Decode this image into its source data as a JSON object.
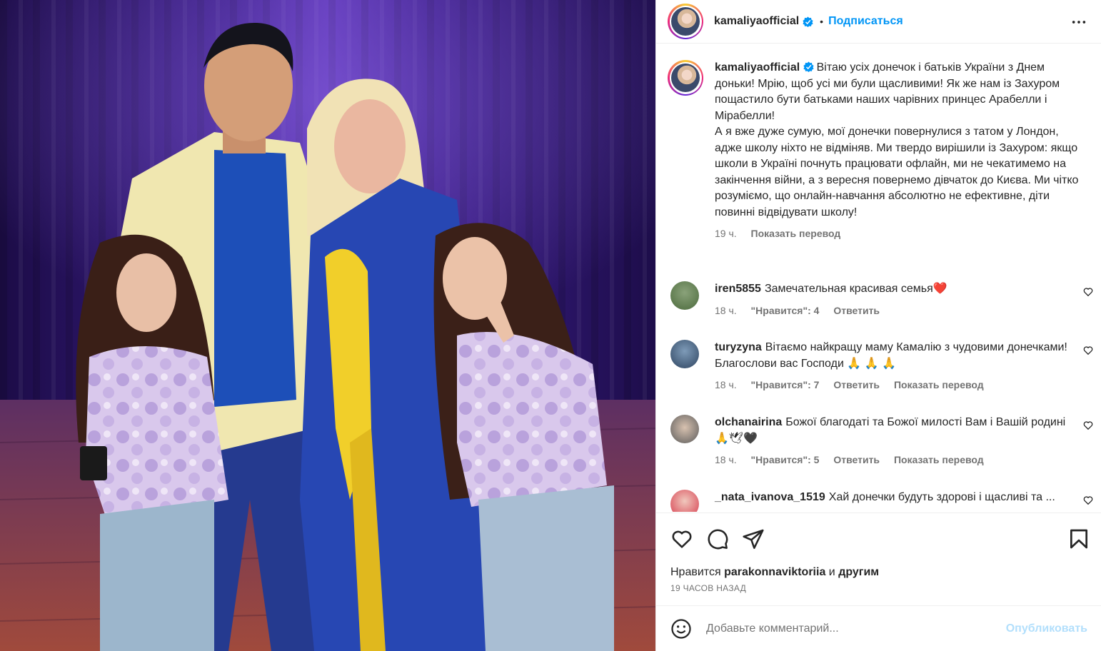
{
  "header": {
    "username": "kamaliyaofficial",
    "dot": "•",
    "follow_label": "Подписаться"
  },
  "caption": {
    "username": "kamaliyaofficial",
    "text": "Вітаю усіх донечок і батьків України з Днем доньки! Мрію, щоб усі ми були щасливими! Як же нам із Захуром пощастило бути батьками наших чарівних принцес Арабелли і Мірабелли!\nА я вже дуже сумую, мої донечки повернулися з татом у Лондон, адже школу ніхто не відміняв. Ми твердо вирішили із Захуром: якщо школи в Україні почнуть працювати офлайн, ми не чекатимемо на закінчення війни, а з вересня повернемо дівчаток до Києва. Ми чітко розуміємо, що онлайн-навчання абсолютно не ефективне, діти повинні відвідувати школу!",
    "time": "19 ч.",
    "translate": "Показать перевод"
  },
  "comments": [
    {
      "username": "iren5855",
      "text": "Замечательная красивая семья❤️",
      "time": "18 ч.",
      "likes": "\"Нравится\": 4",
      "reply": "Ответить",
      "translate": ""
    },
    {
      "username": "turyzyna",
      "text": "Вітаємо найкращу маму Камалію з чудовими донечками! Благослови вас Господи 🙏 🙏 🙏",
      "time": "18 ч.",
      "likes": "\"Нравится\": 7",
      "reply": "Ответить",
      "translate": "Показать перевод"
    },
    {
      "username": "olchanairina",
      "text": "Божої благодаті та Божої милості Вам і Вашій родині 🙏🕊🖤",
      "time": "18 ч.",
      "likes": "\"Нравится\": 5",
      "reply": "Ответить",
      "translate": "Показать перевод"
    },
    {
      "username": "_nata_ivanova_1519",
      "text": "Хай донечки будуть здорові і щасливі та ...",
      "time": "",
      "likes": "",
      "reply": "",
      "translate": ""
    }
  ],
  "likes": {
    "prefix": "Нравится",
    "user": "parakonnaviktoriia",
    "conj": "и",
    "others": "другим"
  },
  "timestamp": "19 ЧАСОВ НАЗАД",
  "add_comment": {
    "placeholder": "Добавьте комментарий...",
    "publish": "Опубликовать"
  },
  "icons": {
    "like": "heart-icon",
    "comment": "comment-icon",
    "share": "send-icon",
    "save": "bookmark-icon",
    "more": "more-icon",
    "emoji": "emoji-icon",
    "verified": "verified-badge-icon"
  },
  "colors": {
    "accent": "#0095f6",
    "publish_disabled": "#b2dffc",
    "secondary": "#737373"
  }
}
